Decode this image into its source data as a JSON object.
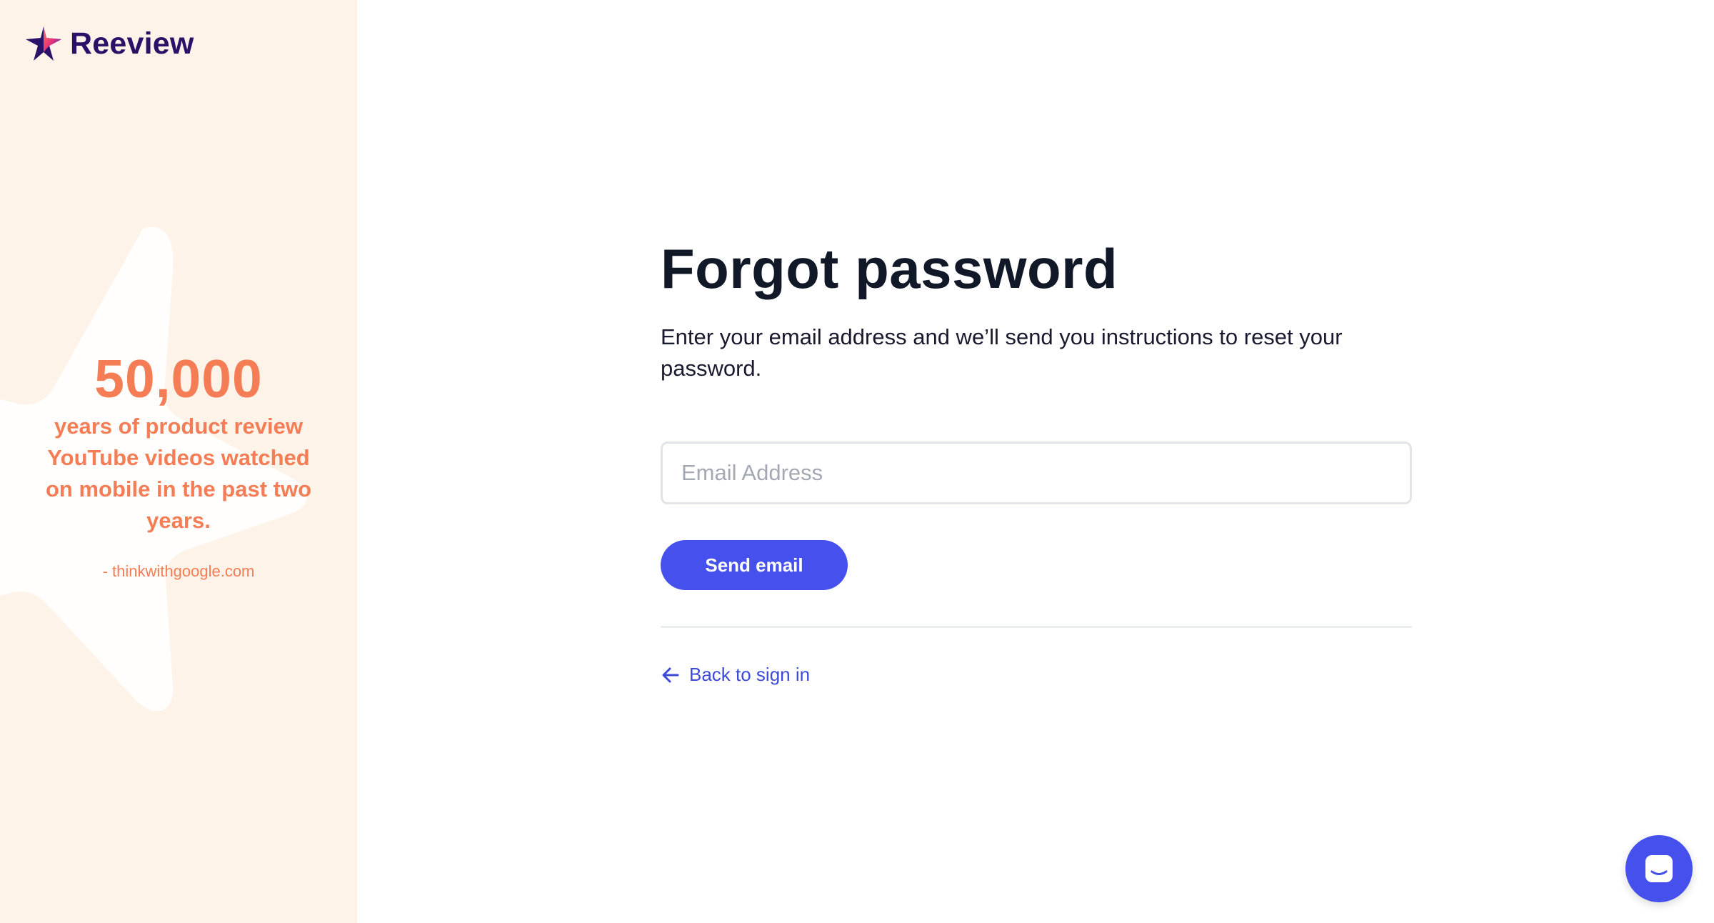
{
  "brand": {
    "name": "Reeview",
    "logo_icon": "star-logo-icon",
    "colors": {
      "primary": "#4650ec",
      "brand_text": "#2a1268",
      "accent": "#f57d56",
      "panel_bg": "#fef3e9"
    }
  },
  "promo": {
    "stat_number": "50,000",
    "stat_description": "years of product review YouTube videos watched on mobile in the past two years.",
    "source": "- thinkwithgoogle.com"
  },
  "form": {
    "title": "Forgot password",
    "subtitle": "Enter your email address and we’ll send you instructions to reset your password.",
    "email_placeholder": "Email Address",
    "email_value": "",
    "submit_label": "Send email",
    "back_link_label": "Back to sign in",
    "back_icon": "arrow-left-icon"
  },
  "chat": {
    "icon": "chat-icon"
  }
}
